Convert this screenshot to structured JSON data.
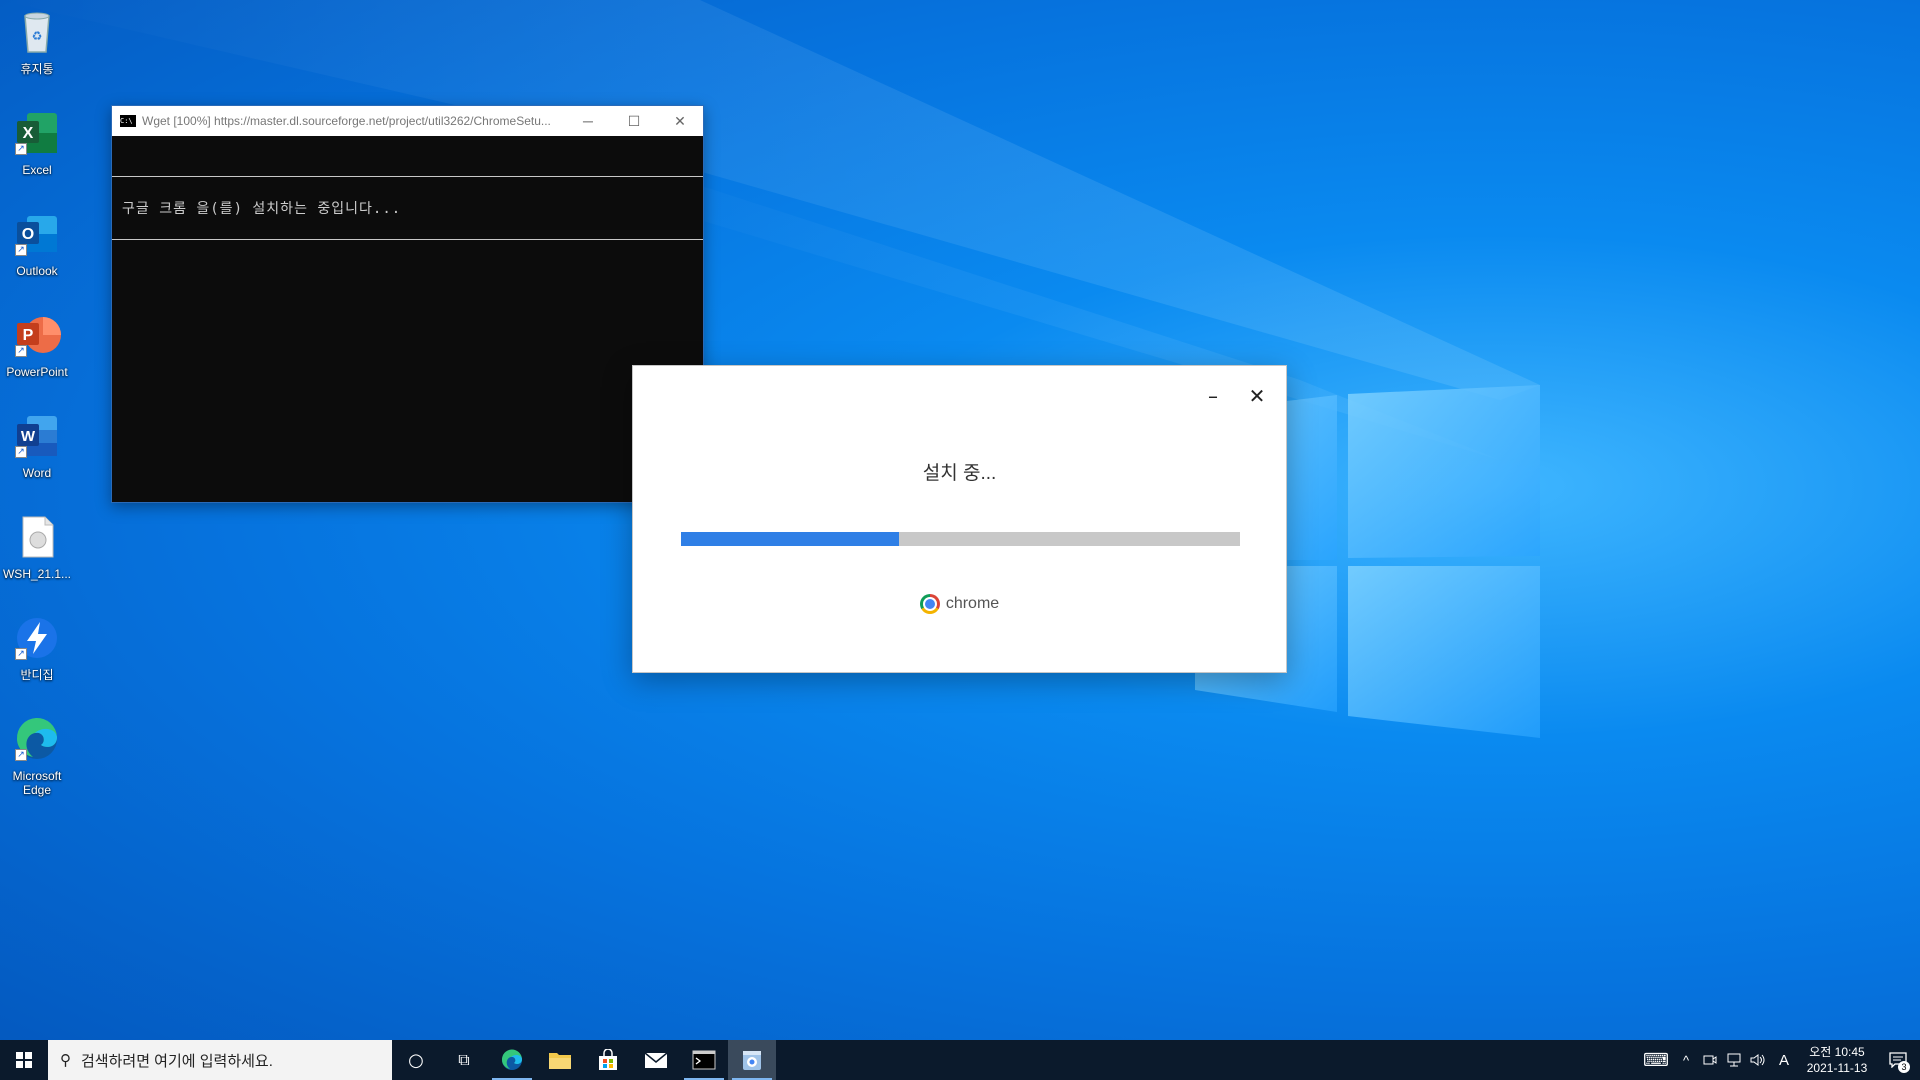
{
  "desktop": {
    "icons": [
      {
        "label": "휴지통",
        "icon": "recycle-bin-icon"
      },
      {
        "label": "Excel",
        "icon": "excel-icon",
        "letter": "X",
        "color": "#1f7a45"
      },
      {
        "label": "Outlook",
        "icon": "outlook-icon",
        "letter": "O",
        "color": "#0f64c0"
      },
      {
        "label": "PowerPoint",
        "icon": "powerpoint-icon",
        "letter": "P",
        "color": "#d04a2c"
      },
      {
        "label": "Word",
        "icon": "word-icon",
        "letter": "W",
        "color": "#1e5bb8"
      },
      {
        "label": "WSH_21.1...",
        "icon": "file-icon"
      },
      {
        "label": "반디집",
        "icon": "bandizip-icon"
      },
      {
        "label": "Microsoft Edge",
        "icon": "edge-icon"
      }
    ],
    "shortcut_glyph": "↗"
  },
  "console": {
    "title": "Wget [100%] https://master.dl.sourceforge.net/project/util3262/ChromeSetu...",
    "icon_text": "C:\\",
    "minimize": "─",
    "maximize": "☐",
    "close": "✕",
    "message": "구글 크롬 을(를) 설치하는 중입니다..."
  },
  "installer": {
    "minimize": "–",
    "close": "✕",
    "status": "설치 중...",
    "progress": 0.39,
    "brand": "chrome"
  },
  "taskbar": {
    "search_placeholder": "검색하려면 여기에 입력하세요.",
    "search_icon": "⚲",
    "cortana": "○",
    "task_view": "⧉",
    "apps": [
      "edge-icon",
      "file-explorer-icon",
      "store-icon",
      "mail-icon",
      "terminal-icon",
      "installer-icon"
    ],
    "tray": {
      "keyboard": "⌨",
      "chevron": "^",
      "ime": "A",
      "clock_time": "오전 10:45",
      "clock_date": "2021-11-13",
      "notification_count": "3"
    }
  },
  "colors": {
    "progress_fill": "#2f7fe6",
    "progress_track": "#c8c8c8",
    "taskbar": "#0b1a2c"
  }
}
